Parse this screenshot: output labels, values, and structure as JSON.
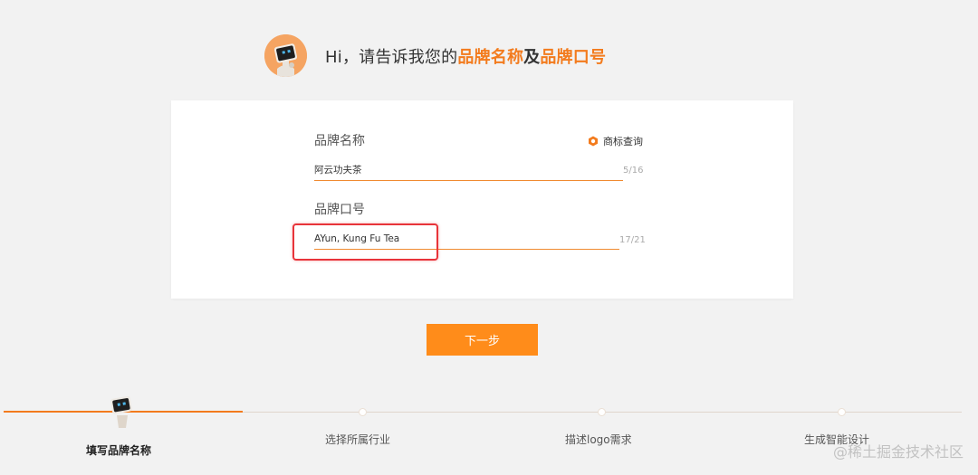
{
  "greeting": {
    "prefix": "Hi，请告诉我您的",
    "brand_name_hl": "品牌名称",
    "joiner": "及",
    "slogan_hl": "品牌口号"
  },
  "form": {
    "brand_name": {
      "label": "品牌名称",
      "value": "阿云功夫茶",
      "counter": "5/16"
    },
    "trademark_query_label": "商标查询",
    "slogan": {
      "label": "品牌口号",
      "value": "AYun, Kung Fu Tea",
      "counter": "17/21"
    }
  },
  "next_button_label": "下一步",
  "steps": [
    {
      "label": "填写品牌名称",
      "active": true
    },
    {
      "label": "选择所属行业",
      "active": false
    },
    {
      "label": "描述logo需求",
      "active": false
    },
    {
      "label": "生成智能设计",
      "active": false
    }
  ],
  "watermark": "@稀土掘金技术社区",
  "colors": {
    "accent": "#f37b1d",
    "button": "#ff8c1a",
    "highlight_box": "#e8343a",
    "background": "#f2f2f2"
  }
}
